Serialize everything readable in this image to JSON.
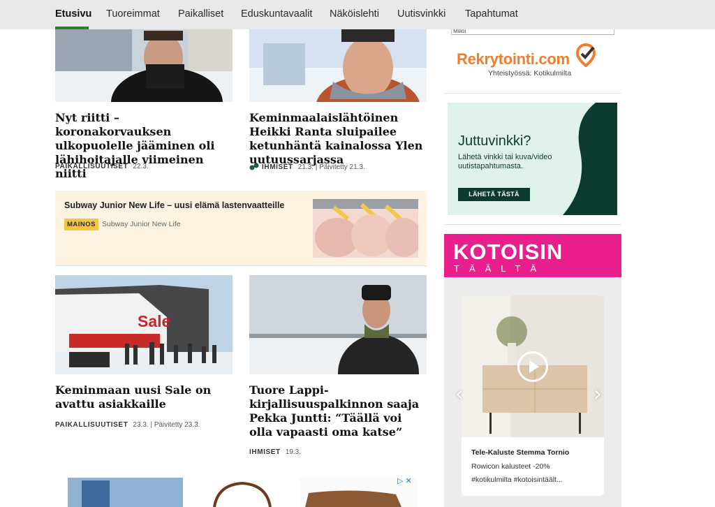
{
  "nav": {
    "items": [
      "Etusivu",
      "Tuoreimmat",
      "Paikalliset",
      "Eduskuntavaalit",
      "Näköislehti",
      "Uutisvinkki",
      "Tapahtumat"
    ],
    "active": "Etusivu"
  },
  "articles": [
    {
      "headline": "Nyt riitti – koronakorvauksen ulkopuolelle jääminen oli lähihoitajalle viimeinen niitti",
      "category": "PAIKALLISUUTISET",
      "date": "22.3."
    },
    {
      "headline": "Keminmaalaislähtöinen Heikki Ranta sluipailee ketunhäntä kainalossa Ylen uutuussarjassa",
      "category": "IHMISET",
      "date": "21.3. | Päivitetty 21.3."
    },
    {
      "headline": "Keminmaan uusi Sale on avattu asiakkaille",
      "category": "PAIKALLISUUTISET",
      "date": "23.3. | Päivitetty 23.3."
    },
    {
      "headline": "Tuore Lappi-kirjallisuuspalkinnon saaja Pekka Juntti: “Täällä voi olla vapaasti oma katse”",
      "category": "IHMISET",
      "date": "19.3."
    }
  ],
  "sponsored": {
    "title": "Subway Junior New Life – uusi elämä lastenvaatteille",
    "badge": "MAINOS",
    "sponsor": "Subway Junior New Life"
  },
  "sale_sign": "Sale",
  "sidebar": {
    "rekry_cut_text": "Milloi",
    "rekry_logo": "Rekrytointi.com",
    "rekry_sub": "Yhteistyössä: Kotikulmilta",
    "tip": {
      "title": "Juttuvinkki?",
      "text": "Lähetä vinkki tai kuva/video uutistapahtumasta.",
      "button": "LÄHETÄ TÄSTÄ"
    },
    "kotoisin": {
      "logo_top": "KOTOISIN",
      "logo_bottom": "TÄÄLTÄ",
      "card_title": "Tele-Kaluste Stemma Tornio",
      "card_line1": "Rowicon kalusteet -20%",
      "card_line2": "#kotikulmilta #kotoisintäält..."
    }
  },
  "colors": {
    "accent_green": "#2e7d32",
    "rekry_orange": "#ef7d2b",
    "tip_bg": "#dff3ea",
    "tip_dark": "#0b3a30",
    "kotoisin_pink": "#ea1e8c",
    "mainos_yellow": "#f6c545"
  }
}
